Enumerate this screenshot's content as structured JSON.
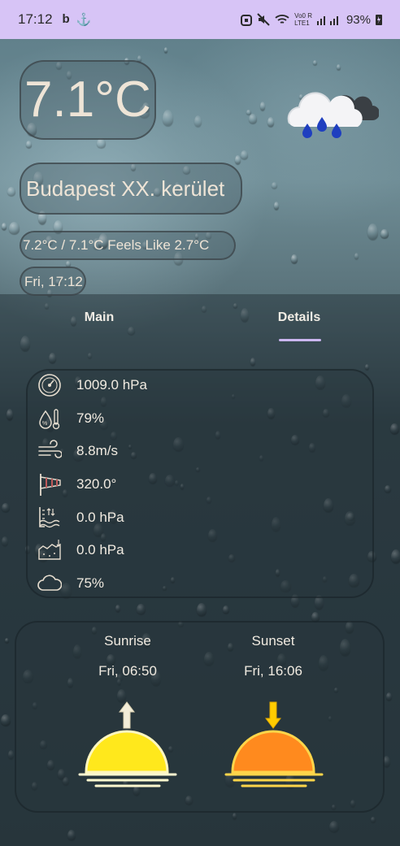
{
  "status_bar": {
    "time": "17:12",
    "left_icons": [
      "b",
      "⚓"
    ],
    "network_labels": [
      "Vo0 R",
      "LTE1"
    ],
    "battery": "93%"
  },
  "weather": {
    "temperature": "7.1°C",
    "city": "Budapest XX. kerület",
    "min_max_feels": "7.2°C / 7.1°C Feels Like 2.7°C",
    "date_time": "Fri, 17:12",
    "condition_icon": "rain-cloud-icon"
  },
  "tabs": [
    {
      "label": "Main",
      "selected": false
    },
    {
      "label": "Details",
      "selected": true
    }
  ],
  "details": [
    {
      "icon": "barometer-icon",
      "value": "1009.0 hPa"
    },
    {
      "icon": "humidity-icon",
      "value": "79%"
    },
    {
      "icon": "wind-icon",
      "value": "8.8m/s"
    },
    {
      "icon": "windsock-icon",
      "value": "320.0°"
    },
    {
      "icon": "sea-level-icon",
      "value": "0.0 hPa"
    },
    {
      "icon": "ground-level-icon",
      "value": "0.0 hPa"
    },
    {
      "icon": "cloud-icon",
      "value": "75%"
    }
  ],
  "sun": {
    "sunrise_label": "Sunrise",
    "sunrise_time": "Fri, 06:50",
    "sunset_label": "Sunset",
    "sunset_time": "Fri, 16:06",
    "sunrise_color": "#ffe81c",
    "sunset_color": "#ff8a1e"
  }
}
